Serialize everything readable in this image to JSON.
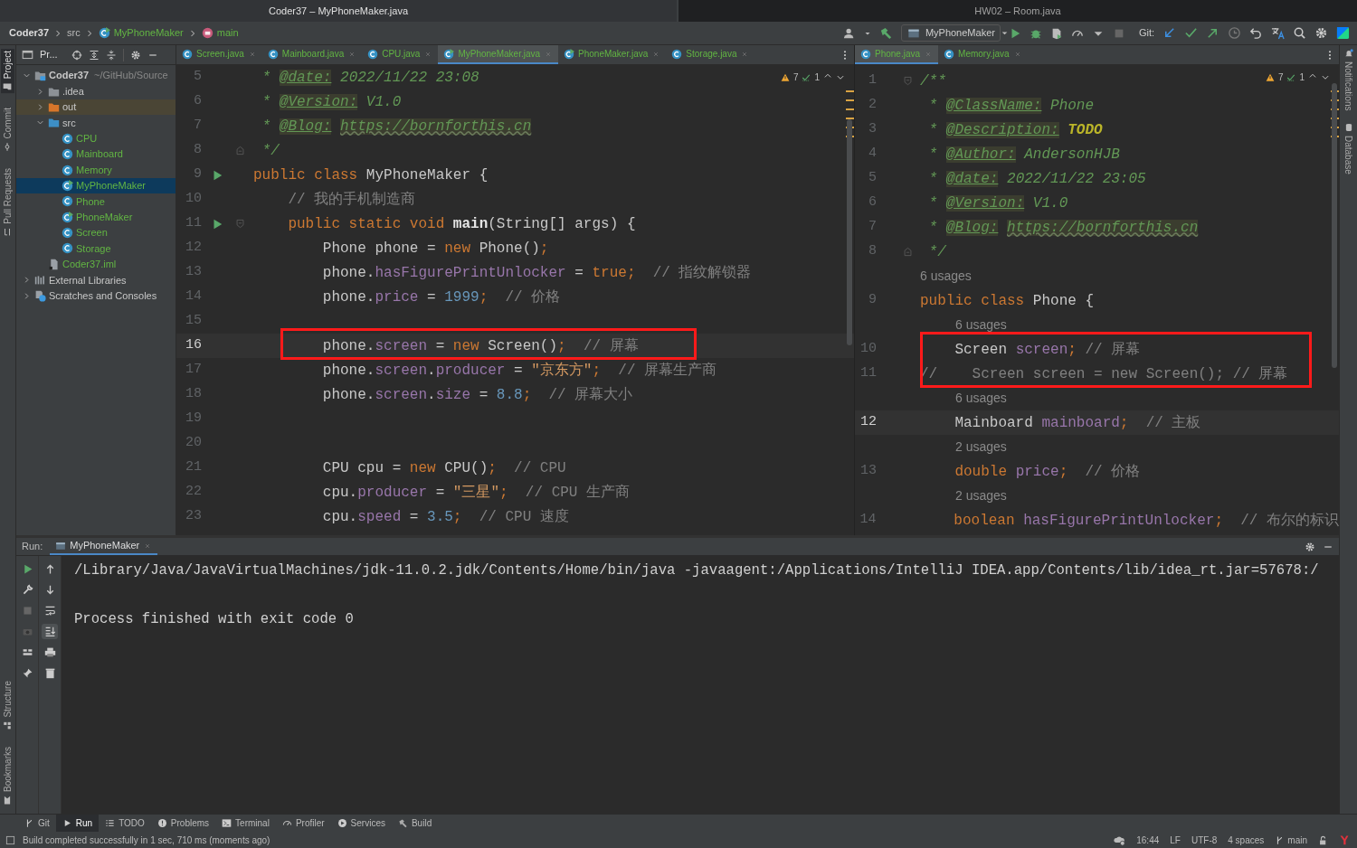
{
  "windows": [
    {
      "title": "Coder37 – MyPhoneMaker.java",
      "selected": true
    },
    {
      "title": "HW02 – Room.java",
      "selected": false
    }
  ],
  "breadcrumbs": [
    {
      "label": "Coder37",
      "kind": "project"
    },
    {
      "label": "src",
      "kind": "folder"
    },
    {
      "label": "MyPhoneMaker",
      "kind": "main-class"
    },
    {
      "label": "main",
      "kind": "method"
    }
  ],
  "toolbar": {
    "run_config": "MyPhoneMaker",
    "git_label": "Git:"
  },
  "left_tool_windows": {
    "top": [
      {
        "label": "Project",
        "selected": true
      },
      {
        "label": "Commit",
        "selected": false
      },
      {
        "label": "Pull Requests",
        "selected": false
      }
    ],
    "bottom": [
      {
        "label": "Structure",
        "selected": false
      },
      {
        "label": "Bookmarks",
        "selected": false
      }
    ]
  },
  "right_tool_windows": [
    {
      "label": "Notifications"
    },
    {
      "label": "Database"
    }
  ],
  "project_panel": {
    "title": "Pr...",
    "tree": [
      {
        "label": "Coder37",
        "kind": "module",
        "hint": "~/GitHub/Source",
        "expanded": true,
        "selected": false,
        "added": false,
        "children": [
          {
            "label": ".idea",
            "kind": "folder",
            "expanded": false,
            "selected": false,
            "added": false
          },
          {
            "label": "out",
            "kind": "excluded-folder",
            "expanded": false,
            "selected": false,
            "added": false
          },
          {
            "label": "src",
            "kind": "source-folder",
            "expanded": true,
            "selected": false,
            "added": false,
            "children": [
              {
                "label": "CPU",
                "kind": "class",
                "selected": false,
                "added": true
              },
              {
                "label": "Mainboard",
                "kind": "class",
                "selected": false,
                "added": true
              },
              {
                "label": "Memory",
                "kind": "class",
                "selected": false,
                "added": true
              },
              {
                "label": "MyPhoneMaker",
                "kind": "main-class",
                "selected": true,
                "added": true
              },
              {
                "label": "Phone",
                "kind": "class",
                "selected": false,
                "added": true
              },
              {
                "label": "PhoneMaker",
                "kind": "main-class",
                "selected": false,
                "added": true
              },
              {
                "label": "Screen",
                "kind": "class",
                "selected": false,
                "added": true
              },
              {
                "label": "Storage",
                "kind": "class",
                "selected": false,
                "added": true
              }
            ]
          },
          {
            "label": "Coder37.iml",
            "kind": "file",
            "selected": false,
            "added": true
          }
        ]
      },
      {
        "label": "External Libraries",
        "kind": "library",
        "expanded": false,
        "selected": false,
        "added": false
      },
      {
        "label": "Scratches and Consoles",
        "kind": "scratch",
        "expanded": false,
        "selected": false,
        "added": false
      }
    ]
  },
  "editors": [
    {
      "tabs": [
        {
          "label": "Screen.java",
          "kind": "class",
          "selected": false
        },
        {
          "label": "Mainboard.java",
          "kind": "class",
          "selected": false
        },
        {
          "label": "CPU.java",
          "kind": "class",
          "selected": false
        },
        {
          "label": "MyPhoneMaker.java",
          "kind": "main-class",
          "selected": true
        },
        {
          "label": "PhoneMaker.java",
          "kind": "main-class",
          "selected": false
        },
        {
          "label": "Storage.java",
          "kind": "class",
          "selected": false
        }
      ],
      "inspections": {
        "warnings": "7",
        "weak_warnings": "1"
      },
      "lines": [
        {
          "kind": "code",
          "number": "5",
          "tokens": [
            {
              "kind": "doc",
              "text": " * "
            },
            {
              "kind": "tag",
              "text": "@date:"
            },
            {
              "kind": "doc",
              "text": " 2022/11/22 23:08"
            }
          ]
        },
        {
          "kind": "code",
          "number": "6",
          "tokens": [
            {
              "kind": "doc",
              "text": " * "
            },
            {
              "kind": "tag",
              "text": "@Version:"
            },
            {
              "kind": "doc",
              "text": " V1.0"
            }
          ]
        },
        {
          "kind": "code",
          "number": "7",
          "tokens": [
            {
              "kind": "doc",
              "text": " * "
            },
            {
              "kind": "tag",
              "text": "@Blog:"
            },
            {
              "kind": "link",
              "text": "https://bornforthis.cn"
            }
          ]
        },
        {
          "kind": "code",
          "number": "8",
          "fold_end": true,
          "tokens": [
            {
              "kind": "doc",
              "text": " */"
            }
          ]
        },
        {
          "kind": "code",
          "number": "9",
          "run": true,
          "tokens": [
            {
              "kind": "kw",
              "text": "public class "
            },
            {
              "kind": "plain",
              "text": "MyPhoneMaker {"
            }
          ]
        },
        {
          "kind": "code",
          "number": "10",
          "tokens": [
            {
              "kind": "com",
              "text": "    // 我的手机制造商"
            }
          ]
        },
        {
          "kind": "code",
          "number": "11",
          "run": true,
          "fold_start": true,
          "tokens": [
            {
              "kind": "kw",
              "text": "    public static void "
            },
            {
              "kind": "decl",
              "text": "main"
            },
            {
              "kind": "plain",
              "text": "(String[] args) {"
            }
          ]
        },
        {
          "kind": "code",
          "number": "12",
          "tokens": [
            {
              "kind": "plain",
              "text": "        Phone phone = "
            },
            {
              "kind": "kw",
              "text": "new "
            },
            {
              "kind": "plain",
              "text": "Phone()"
            },
            {
              "kind": "kw",
              "text": ";"
            }
          ]
        },
        {
          "kind": "code",
          "number": "13",
          "tokens": [
            {
              "kind": "plain",
              "text": "        phone."
            },
            {
              "kind": "field",
              "text": "hasFigurePrintUnlocker"
            },
            {
              "kind": "plain",
              "text": " = "
            },
            {
              "kind": "kw",
              "text": "true;"
            },
            {
              "kind": "com",
              "text": "  // 指纹解锁器"
            }
          ]
        },
        {
          "kind": "code",
          "number": "14",
          "tokens": [
            {
              "kind": "plain",
              "text": "        phone."
            },
            {
              "kind": "field",
              "text": "price"
            },
            {
              "kind": "plain",
              "text": " = "
            },
            {
              "kind": "num",
              "text": "1999"
            },
            {
              "kind": "kw",
              "text": ";"
            },
            {
              "kind": "com",
              "text": "  // 价格"
            }
          ]
        },
        {
          "kind": "code",
          "number": "15"
        },
        {
          "kind": "code",
          "number": "16",
          "current": true,
          "boxed": true,
          "tokens": [
            {
              "kind": "plain",
              "text": "        phone."
            },
            {
              "kind": "field",
              "text": "screen"
            },
            {
              "kind": "plain",
              "text": " = "
            },
            {
              "kind": "kw",
              "text": "new "
            },
            {
              "kind": "plain",
              "text": "Screen()"
            },
            {
              "kind": "kw",
              "text": ";"
            },
            {
              "kind": "com",
              "text": "  // 屏幕"
            }
          ]
        },
        {
          "kind": "code",
          "number": "17",
          "tokens": [
            {
              "kind": "plain",
              "text": "        phone."
            },
            {
              "kind": "field",
              "text": "screen"
            },
            {
              "kind": "plain",
              "text": "."
            },
            {
              "kind": "field",
              "text": "producer"
            },
            {
              "kind": "plain",
              "text": " = "
            },
            {
              "kind": "str",
              "text": "\"京东方\""
            },
            {
              "kind": "kw",
              "text": ";"
            },
            {
              "kind": "com",
              "text": "  // 屏幕生产商"
            }
          ]
        },
        {
          "kind": "code",
          "number": "18",
          "tokens": [
            {
              "kind": "plain",
              "text": "        phone."
            },
            {
              "kind": "field",
              "text": "screen"
            },
            {
              "kind": "plain",
              "text": "."
            },
            {
              "kind": "field",
              "text": "size"
            },
            {
              "kind": "plain",
              "text": " = "
            },
            {
              "kind": "num",
              "text": "8.8"
            },
            {
              "kind": "kw",
              "text": ";"
            },
            {
              "kind": "com",
              "text": "  // 屏幕大小"
            }
          ]
        },
        {
          "kind": "code",
          "number": "19"
        },
        {
          "kind": "code",
          "number": "20"
        },
        {
          "kind": "code",
          "number": "21",
          "tokens": [
            {
              "kind": "plain",
              "text": "        CPU cpu = "
            },
            {
              "kind": "kw",
              "text": "new "
            },
            {
              "kind": "plain",
              "text": "CPU()"
            },
            {
              "kind": "kw",
              "text": ";"
            },
            {
              "kind": "com",
              "text": "  // CPU"
            }
          ]
        },
        {
          "kind": "code",
          "number": "22",
          "tokens": [
            {
              "kind": "plain",
              "text": "        cpu."
            },
            {
              "kind": "field",
              "text": "producer"
            },
            {
              "kind": "plain",
              "text": " = "
            },
            {
              "kind": "str",
              "text": "\"三星\""
            },
            {
              "kind": "kw",
              "text": ";"
            },
            {
              "kind": "com",
              "text": "  // CPU 生产商"
            }
          ]
        },
        {
          "kind": "code",
          "number": "23",
          "tokens": [
            {
              "kind": "plain",
              "text": "        cpu."
            },
            {
              "kind": "field",
              "text": "speed"
            },
            {
              "kind": "plain",
              "text": " = "
            },
            {
              "kind": "num",
              "text": "3.5"
            },
            {
              "kind": "kw",
              "text": ";"
            },
            {
              "kind": "com",
              "text": "  // CPU 速度"
            }
          ]
        }
      ]
    },
    {
      "tabs": [
        {
          "label": "Phone.java",
          "kind": "class",
          "selected": true
        },
        {
          "label": "Memory.java",
          "kind": "class",
          "selected": false
        }
      ],
      "inspections": {
        "warnings": "7",
        "weak_warnings": "1"
      },
      "lines": [
        {
          "kind": "code",
          "number": "1",
          "fold_start": true,
          "tokens": [
            {
              "kind": "doc",
              "text": "/**"
            }
          ]
        },
        {
          "kind": "code",
          "number": "2",
          "tokens": [
            {
              "kind": "doc",
              "text": " * "
            },
            {
              "kind": "tag",
              "text": "@ClassName:"
            },
            {
              "kind": "doc",
              "text": " Phone"
            }
          ]
        },
        {
          "kind": "code",
          "number": "3",
          "tokens": [
            {
              "kind": "doc",
              "text": " * "
            },
            {
              "kind": "tag",
              "text": "@Description:"
            },
            {
              "kind": "todo",
              "text": "TODO"
            }
          ]
        },
        {
          "kind": "code",
          "number": "4",
          "tokens": [
            {
              "kind": "doc",
              "text": " * "
            },
            {
              "kind": "tag",
              "text": "@Author:"
            },
            {
              "kind": "doc",
              "text": " AndersonHJB"
            }
          ]
        },
        {
          "kind": "code",
          "number": "5",
          "tokens": [
            {
              "kind": "doc",
              "text": " * "
            },
            {
              "kind": "tag",
              "text": "@date:"
            },
            {
              "kind": "doc",
              "text": " 2022/11/22 23:05"
            }
          ]
        },
        {
          "kind": "code",
          "number": "6",
          "tokens": [
            {
              "kind": "doc",
              "text": " * "
            },
            {
              "kind": "tag",
              "text": "@Version:"
            },
            {
              "kind": "doc",
              "text": " V1.0"
            }
          ]
        },
        {
          "kind": "code",
          "number": "7",
          "tokens": [
            {
              "kind": "doc",
              "text": " * "
            },
            {
              "kind": "tag",
              "text": "@Blog:"
            },
            {
              "kind": "link",
              "text": "https://bornforthis.cn"
            }
          ]
        },
        {
          "kind": "code",
          "number": "8",
          "fold_end": true,
          "tokens": [
            {
              "kind": "doc",
              "text": " */"
            }
          ]
        },
        {
          "kind": "hint",
          "text": "6 usages"
        },
        {
          "kind": "code",
          "number": "9",
          "tokens": [
            {
              "kind": "kw",
              "text": "public class "
            },
            {
              "kind": "plain",
              "text": "Phone {"
            }
          ]
        },
        {
          "kind": "hint",
          "text": "6 usages",
          "indented": true
        },
        {
          "kind": "code",
          "number": "10",
          "boxed": true,
          "tokens": [
            {
              "kind": "plain",
              "text": "    Screen "
            },
            {
              "kind": "field",
              "text": "screen"
            },
            {
              "kind": "kw",
              "text": ";"
            },
            {
              "kind": "com",
              "text": " // 屏幕"
            }
          ]
        },
        {
          "kind": "code",
          "number": "11",
          "boxed": true,
          "tokens": [
            {
              "kind": "com",
              "text": "//    Screen screen = new Screen(); // 屏幕"
            }
          ]
        },
        {
          "kind": "hint",
          "text": "6 usages",
          "indented": true
        },
        {
          "kind": "code",
          "number": "12",
          "current": true,
          "tokens": [
            {
              "kind": "plain",
              "text": "    Mainboard "
            },
            {
              "kind": "field",
              "text": "mainboard"
            },
            {
              "kind": "kw",
              "text": ";"
            },
            {
              "kind": "com",
              "text": "  // 主板"
            }
          ]
        },
        {
          "kind": "hint",
          "text": "2 usages",
          "indented": true
        },
        {
          "kind": "code",
          "number": "13",
          "tokens": [
            {
              "kind": "kw",
              "text": "    double "
            },
            {
              "kind": "field",
              "text": "price"
            },
            {
              "kind": "kw",
              "text": ";"
            },
            {
              "kind": "com",
              "text": "  // 价格"
            }
          ]
        },
        {
          "kind": "hint",
          "text": "2 usages",
          "indented": true
        },
        {
          "kind": "code",
          "number": "14",
          "tokens": [
            {
              "kind": "kw",
              "text": "    boolean "
            },
            {
              "kind": "field",
              "text": "hasFigurePrintUnlocker"
            },
            {
              "kind": "kw",
              "text": ";"
            },
            {
              "kind": "com",
              "text": "  // 布尔的标识"
            }
          ]
        }
      ]
    }
  ],
  "run_panel": {
    "label": "Run:",
    "tab": "MyPhoneMaker",
    "console": [
      {
        "kind": "command",
        "text": "/Library/Java/JavaVirtualMachines/jdk-11.0.2.jdk/Contents/Home/bin/java -javaagent:/Applications/IntelliJ IDEA.app/Contents/lib/idea_rt.jar=57678:/"
      },
      {
        "kind": "output",
        "text": "Process finished with exit code 0"
      }
    ]
  },
  "tool_tabs": [
    {
      "label": "Git",
      "kind": "git",
      "selected": false
    },
    {
      "label": "Run",
      "kind": "run",
      "selected": true
    },
    {
      "label": "TODO",
      "kind": "todo",
      "selected": false
    },
    {
      "label": "Problems",
      "kind": "problems",
      "selected": false
    },
    {
      "label": "Terminal",
      "kind": "terminal",
      "selected": false
    },
    {
      "label": "Profiler",
      "kind": "profiler",
      "selected": false
    },
    {
      "label": "Services",
      "kind": "services",
      "selected": false
    },
    {
      "label": "Build",
      "kind": "build",
      "selected": false
    }
  ],
  "status_bar": {
    "message": "Build completed successfully in 1 sec, 710 ms (moments ago)",
    "items": [
      {
        "text": "16:44",
        "kind": "time"
      },
      {
        "text": "LF",
        "kind": "plain"
      },
      {
        "text": "UTF-8",
        "kind": "plain"
      },
      {
        "text": "4 spaces",
        "kind": "plain"
      },
      {
        "text": "main",
        "kind": "branch"
      }
    ]
  }
}
